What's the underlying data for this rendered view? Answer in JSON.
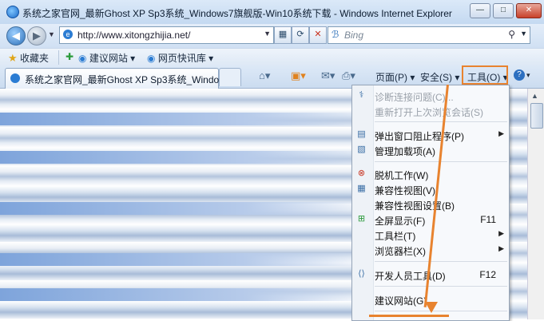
{
  "window": {
    "title": "系统之家官网_最新Ghost XP Sp3系统_Windows7旗舰版-Win10系统下载 - Windows Internet Explorer",
    "min": "—",
    "max": "□",
    "close": "✕"
  },
  "nav": {
    "back": "◀",
    "forward": "▶",
    "history_drop": "▼",
    "address": "http://www.xitongzhijia.net/",
    "address_drop": "▼",
    "search_placeholder": "Bing",
    "search_drop": "▼"
  },
  "favorites": {
    "favorites_label": "收藏夹",
    "items": [
      {
        "label": "建议网站 ▾"
      },
      {
        "label": "网页快讯库 ▾"
      }
    ]
  },
  "tab": {
    "label": "系统之家官网_最新Ghost XP Sp3系统_Window..."
  },
  "commandbar": {
    "page": "页面(P) ▾",
    "safety": "安全(S) ▾",
    "tools": "工具(O) ▾",
    "help": "?"
  },
  "tools_menu": {
    "items": [
      {
        "label": "诊断连接问题(C)...",
        "key": "",
        "submenu": false,
        "disabled": true,
        "icon": "diagnose-icon"
      },
      {
        "label": "重新打开上次浏览会话(S)",
        "key": "",
        "submenu": false,
        "disabled": true,
        "icon": ""
      },
      {
        "label": "弹出窗口阻止程序(P)",
        "key": "",
        "submenu": true,
        "disabled": false,
        "icon": "popup-blocker-icon"
      },
      {
        "label": "管理加载项(A)",
        "key": "",
        "submenu": false,
        "disabled": false,
        "icon": "addons-icon"
      },
      {
        "label": "脱机工作(W)",
        "key": "",
        "submenu": false,
        "disabled": false,
        "icon": "offline-icon"
      },
      {
        "label": "兼容性视图(V)",
        "key": "",
        "submenu": false,
        "disabled": false,
        "icon": "compat-view-icon"
      },
      {
        "label": "兼容性视图设置(B)",
        "key": "",
        "submenu": false,
        "disabled": false,
        "icon": ""
      },
      {
        "label": "全屏显示(F)",
        "key": "F11",
        "submenu": false,
        "disabled": false,
        "icon": "fullscreen-icon"
      },
      {
        "label": "工具栏(T)",
        "key": "",
        "submenu": true,
        "disabled": false,
        "icon": ""
      },
      {
        "label": "浏览器栏(X)",
        "key": "",
        "submenu": true,
        "disabled": false,
        "icon": ""
      },
      {
        "label": "开发人员工具(D)",
        "key": "F12",
        "submenu": false,
        "disabled": false,
        "icon": "devtools-icon"
      },
      {
        "label": "建议网站(G)",
        "key": "",
        "submenu": false,
        "disabled": false,
        "icon": ""
      }
    ]
  },
  "colors": {
    "highlight": "#e8832f",
    "chrome": "#d0e0f3"
  }
}
